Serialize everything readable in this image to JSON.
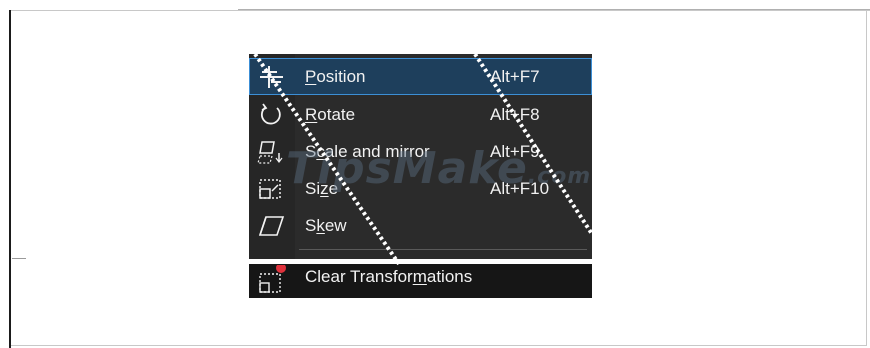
{
  "menu": {
    "items": [
      {
        "icon": "position-icon",
        "pre": "",
        "mnemonic": "P",
        "post": "osition",
        "shortcut": "Alt+F7",
        "selected": true
      },
      {
        "icon": "rotate-icon",
        "pre": "",
        "mnemonic": "R",
        "post": "otate",
        "shortcut": "Alt+F8",
        "selected": false
      },
      {
        "icon": "scale-mirror-icon",
        "pre": "S",
        "mnemonic": "c",
        "post": "ale and mirror",
        "shortcut": "Alt+F9",
        "selected": false
      },
      {
        "icon": "size-icon",
        "pre": "Si",
        "mnemonic": "z",
        "post": "e",
        "shortcut": "Alt+F10",
        "selected": false
      },
      {
        "icon": "skew-icon",
        "pre": "S",
        "mnemonic": "k",
        "post": "ew",
        "shortcut": "",
        "selected": false
      }
    ],
    "clear": {
      "icon": "clear-transformations-icon",
      "pre": "Clear Transfor",
      "mnemonic": "m",
      "post": "ations"
    }
  },
  "watermark": {
    "main": "TipsMake",
    "suffix": ".com"
  },
  "colors": {
    "menu_bg": "#2b2b2b",
    "selection_bg": "#1e3f5c",
    "selection_border": "#3c8fd6",
    "text": "#f2f2f2",
    "badge_red": "#e0323c"
  }
}
